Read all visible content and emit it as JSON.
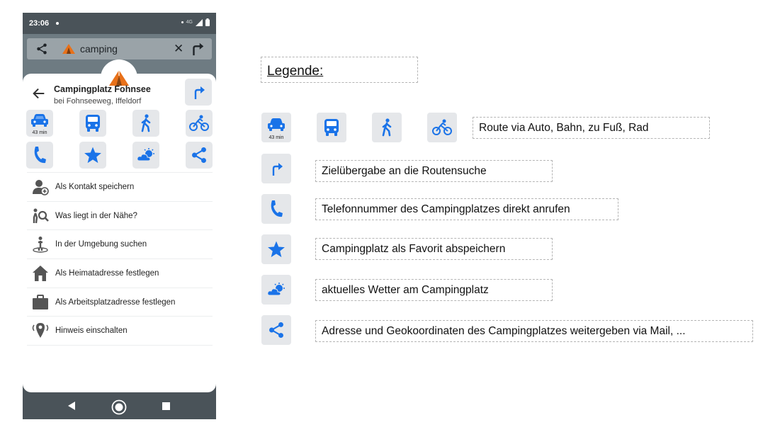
{
  "status_bar": {
    "time": "23:06",
    "network": "4G"
  },
  "search": {
    "query": "camping"
  },
  "place": {
    "title": "Campingplatz Fohnsee",
    "subtitle": "bei Fohnseeweg, Iffeldorf",
    "car_minutes": "43 min"
  },
  "menu": {
    "items": [
      {
        "label": "Als Kontakt speichern",
        "icon": "add-contact-icon"
      },
      {
        "label": "Was liegt in der Nähe?",
        "icon": "nearby-search-icon"
      },
      {
        "label": "In der Umgebung suchen",
        "icon": "surroundings-icon"
      },
      {
        "label": "Als Heimatadresse festlegen",
        "icon": "home-icon"
      },
      {
        "label": "Als Arbeitsplatzadresse festlegen",
        "icon": "briefcase-icon"
      },
      {
        "label": "Hinweis einschalten",
        "icon": "location-alert-icon"
      }
    ]
  },
  "legend": {
    "title": "Legende:",
    "car_minutes": "43 min",
    "items": [
      {
        "text": "Route via Auto, Bahn, zu Fuß, Rad"
      },
      {
        "text": "Zielübergabe an die Routensuche"
      },
      {
        "text": "Telefonnummer des Campingplatzes direkt anrufen"
      },
      {
        "text": "Campingplatz als Favorit abspeichern"
      },
      {
        "text": "aktuelles Wetter am Campingplatz"
      },
      {
        "text": "Adresse und Geokoordinaten des Campingplatzes weitergeben via Mail, ..."
      }
    ]
  },
  "colors": {
    "accent": "#1a73e8",
    "tent": "#e8711a",
    "button_bg": "#e5e7ea",
    "phone_frame": "#4a5359"
  }
}
